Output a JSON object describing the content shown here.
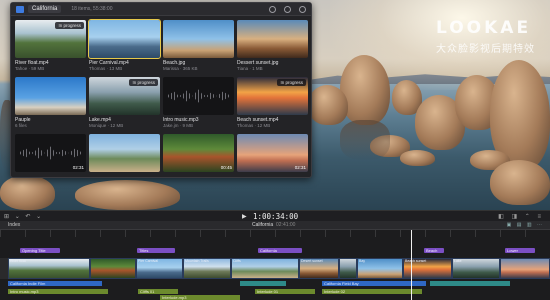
{
  "browser": {
    "library_name": "California",
    "item_count": "18 items, 55:38:00",
    "clips": [
      {
        "title": "River float.mp4",
        "meta": "Tahoe · 59 MB",
        "badge": "In progress",
        "duration": "",
        "style": "river",
        "selected": false
      },
      {
        "title": "Pier Carnival.mp4",
        "meta": "Thomas · 13 MB",
        "badge": "",
        "duration": "",
        "style": "pier",
        "selected": true
      },
      {
        "title": "Beach.jpg",
        "meta": "Marissa · 365 KB",
        "badge": "",
        "duration": "",
        "style": "beach",
        "selected": false
      },
      {
        "title": "Dessert sunset.jpg",
        "meta": "Tiana · 1 MB",
        "badge": "",
        "duration": "",
        "style": "desert",
        "selected": false
      },
      {
        "title": "Pauple",
        "meta": "6 files",
        "badge": "",
        "duration": "",
        "style": "people",
        "selected": false
      },
      {
        "title": "Lake.mp4",
        "meta": "Monique · 12 MB",
        "badge": "In progress",
        "duration": "",
        "style": "lake",
        "selected": false
      },
      {
        "title": "Intro music.mp3",
        "meta": "Jake.jm · 9 MB",
        "badge": "",
        "duration": "",
        "style": "audio",
        "selected": false
      },
      {
        "title": "Beach sunset.mp4",
        "meta": "Thomas · 12 MB",
        "badge": "In progress",
        "duration": "",
        "style": "beachsunset",
        "selected": false
      },
      {
        "title": "",
        "meta": "",
        "badge": "",
        "duration": "02:31",
        "style": "audio2",
        "selected": false
      },
      {
        "title": "",
        "meta": "",
        "badge": "",
        "duration": "",
        "style": "coast",
        "selected": false
      },
      {
        "title": "",
        "meta": "",
        "badge": "",
        "duration": "00:45",
        "style": "forest",
        "selected": false
      },
      {
        "title": "",
        "meta": "",
        "badge": "",
        "duration": "02:31",
        "style": "dusk",
        "selected": false
      }
    ]
  },
  "watermark": {
    "logo": "LOOKAE",
    "subtitle": "大众脸影视后期特效"
  },
  "toolbar": {
    "timecode": "1:00:34:00",
    "tools_glyphs": "⊞ ⌄ ↶ ⌄",
    "play_glyph": "▶",
    "right_glyphs": "◧ ◨ ⌃ ≡"
  },
  "project_bar": {
    "index_label": "Index",
    "project_name": "California",
    "project_duration": "02:41:00",
    "right_glyphs": "▣ ▤ ▥ ⋯"
  },
  "timeline": {
    "title_clips": [
      {
        "label": "Opening Title"
      },
      {
        "label": "Titles"
      },
      {
        "label": "California"
      },
      {
        "label": "Beach"
      },
      {
        "label": "Lower"
      }
    ],
    "video_clips": [
      {
        "label": "River float",
        "style": "river"
      },
      {
        "label": "",
        "style": "forest"
      },
      {
        "label": "Pier Carnival",
        "style": "pier"
      },
      {
        "label": "Mountain Trails",
        "style": "mountain"
      },
      {
        "label": "Cliffs",
        "style": "coast"
      },
      {
        "label": "Desert sunset",
        "style": "desert"
      },
      {
        "label": "",
        "style": "lake"
      },
      {
        "label": "Bay",
        "style": "beach"
      },
      {
        "label": "Beach sunset",
        "style": "beachsunset"
      },
      {
        "label": "Lake",
        "style": "lake"
      },
      {
        "label": "",
        "style": "dusk"
      }
    ],
    "blue_tracks": [
      {
        "label": "California Indie Film"
      },
      {
        "label": "California Field Bay"
      }
    ],
    "audio_tracks": [
      {
        "label": "Intro music.mp3"
      },
      {
        "label": "Cliffs 01"
      },
      {
        "label": "Interlude.mp3"
      },
      {
        "label": "Interlude 01"
      },
      {
        "label": "Interlude 02"
      }
    ]
  }
}
